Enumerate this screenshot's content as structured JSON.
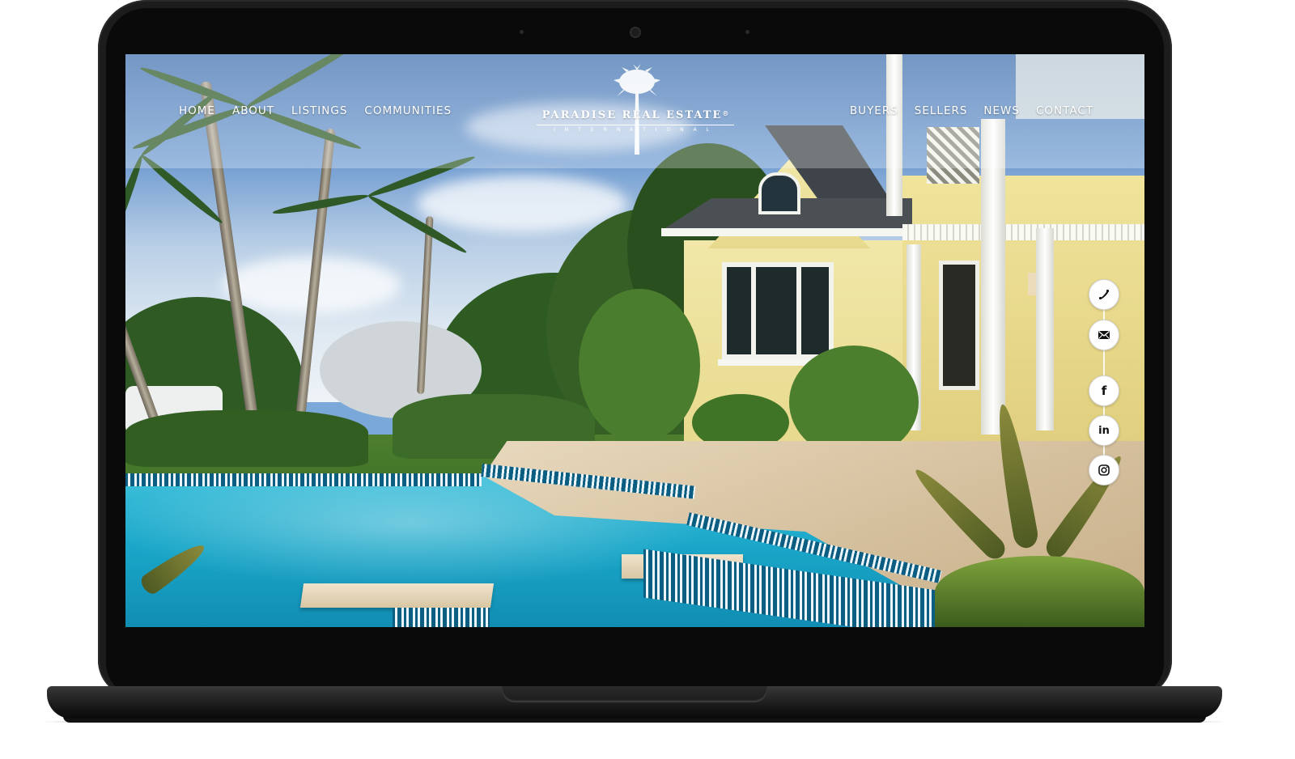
{
  "site": {
    "brand": "PARADISE REAL ESTATE",
    "brand_mark": "®",
    "brand_sub": "INTERNATIONAL"
  },
  "nav": {
    "left": [
      {
        "label": "HOME"
      },
      {
        "label": "ABOUT"
      },
      {
        "label": "LISTINGS"
      },
      {
        "label": "COMMUNITIES"
      }
    ],
    "right": [
      {
        "label": "BUYERS"
      },
      {
        "label": "SELLERS"
      },
      {
        "label": "NEWS"
      },
      {
        "label": "CONTACT"
      }
    ]
  },
  "side_rail": {
    "contact": [
      {
        "icon": "phone-icon",
        "label": "Phone"
      },
      {
        "icon": "envelope-icon",
        "label": "Email"
      }
    ],
    "social": [
      {
        "icon": "facebook-icon",
        "glyph": "f",
        "label": "Facebook"
      },
      {
        "icon": "linkedin-icon",
        "glyph": "in",
        "label": "LinkedIn"
      },
      {
        "icon": "instagram-icon",
        "label": "Instagram"
      }
    ]
  },
  "hero": {
    "scene": "Yellow tropical home with palm trees and turquoise pool"
  },
  "colors": {
    "nav_text": "#ffffff",
    "header_overlay": "rgba(255,255,255,0.28)",
    "device_frame": "#1c1c1c",
    "pool": "#19a6c8"
  }
}
